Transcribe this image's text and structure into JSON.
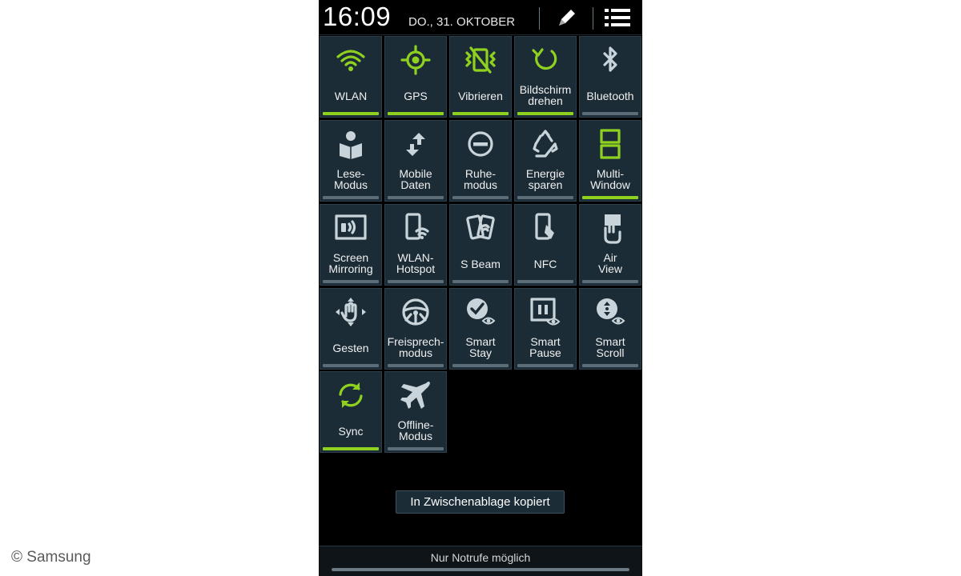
{
  "status": {
    "time": "16:09",
    "date": "DO., 31. OKTOBER"
  },
  "header_buttons": [
    {
      "icon": "pencil-icon"
    },
    {
      "icon": "list-icon"
    }
  ],
  "colors": {
    "active": "#8fd11f",
    "inactive": "#5b6d78",
    "tile_bg": "#1b2c36",
    "icon_active": "#8fd11f",
    "icon_inactive": "#c8d4da"
  },
  "tiles": [
    {
      "label": "WLAN",
      "icon": "wifi-icon",
      "active": true
    },
    {
      "label": "GPS",
      "icon": "gps-icon",
      "active": true
    },
    {
      "label": "Vibrieren",
      "icon": "vibrate-icon",
      "active": true
    },
    {
      "label": "Bildschirm\ndrehen",
      "icon": "rotate-icon",
      "active": true
    },
    {
      "label": "Bluetooth",
      "icon": "bluetooth-icon",
      "active": false
    },
    {
      "label": "Lese-\nModus",
      "icon": "reading-mode-icon",
      "active": false
    },
    {
      "label": "Mobile\nDaten",
      "icon": "mobile-data-icon",
      "active": false
    },
    {
      "label": "Ruhe-\nmodus",
      "icon": "blocking-mode-icon",
      "active": false
    },
    {
      "label": "Energie\nsparen",
      "icon": "power-saving-icon",
      "active": false
    },
    {
      "label": "Multi-\nWindow",
      "icon": "multi-window-icon",
      "active": true
    },
    {
      "label": "Screen\nMirroring",
      "icon": "screen-mirroring-icon",
      "active": false
    },
    {
      "label": "WLAN-\nHotspot",
      "icon": "hotspot-icon",
      "active": false
    },
    {
      "label": "S Beam",
      "icon": "s-beam-icon",
      "active": false
    },
    {
      "label": "NFC",
      "icon": "nfc-icon",
      "active": false
    },
    {
      "label": "Air\nView",
      "icon": "air-view-icon",
      "active": false
    },
    {
      "label": "Gesten",
      "icon": "gesture-icon",
      "active": false
    },
    {
      "label": "Freisprech-\nmodus",
      "icon": "steering-wheel-icon",
      "active": false
    },
    {
      "label": "Smart\nStay",
      "icon": "smart-stay-icon",
      "active": false
    },
    {
      "label": "Smart\nPause",
      "icon": "smart-pause-icon",
      "active": false
    },
    {
      "label": "Smart\nScroll",
      "icon": "smart-scroll-icon",
      "active": false
    },
    {
      "label": "Sync",
      "icon": "sync-icon",
      "active": true
    },
    {
      "label": "Offline-\nModus",
      "icon": "airplane-icon",
      "active": false
    }
  ],
  "toast": "In Zwischenablage kopiert",
  "bottom_text": "Nur Notrufe möglich",
  "credit": "© Samsung"
}
